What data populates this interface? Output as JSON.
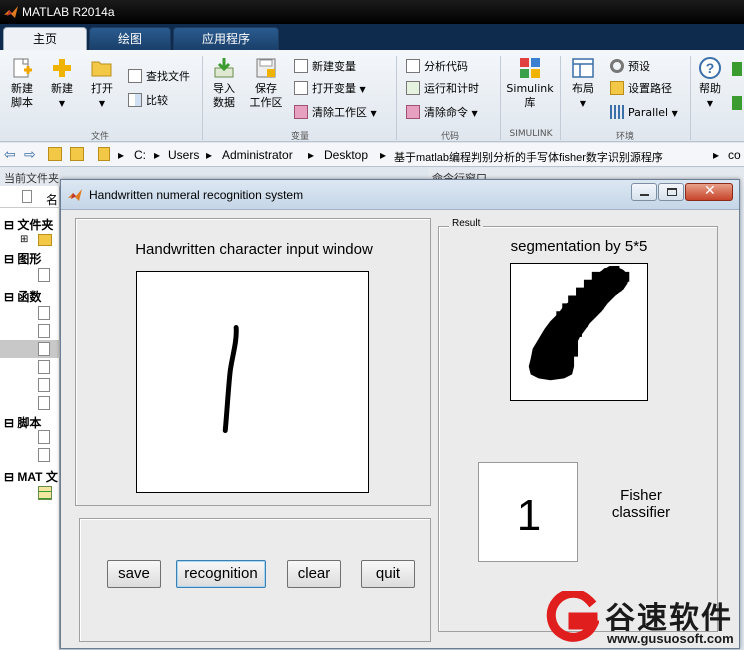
{
  "app": {
    "title": "MATLAB R2014a"
  },
  "tabs": [
    {
      "label": "主页"
    },
    {
      "label": "绘图"
    },
    {
      "label": "应用程序"
    }
  ],
  "ribbon": {
    "new_script": "新建\n脚本",
    "new": "新建",
    "open": "打开",
    "find_files": "查找文件",
    "compare": "比较",
    "import_data": "导入\n数据",
    "save_workspace": "保存\n工作区",
    "new_variable": "新建变量",
    "open_variable": "打开变量",
    "clear_workspace": "清除工作区",
    "analyze_code": "分析代码",
    "run_and_time": "运行和计时",
    "clear_commands": "清除命令",
    "simulink": "Simulink\n库",
    "layout": "布局",
    "preferences": "预设",
    "set_path": "设置路径",
    "parallel": "Parallel",
    "help": "帮助",
    "groups": {
      "file": "文件",
      "variable": "变量",
      "code": "代码",
      "simulink": "SIMULINK",
      "environment": "环境"
    }
  },
  "address": {
    "path": [
      "C:",
      "Users",
      "Administrator",
      "Desktop",
      "基于matlab编程判别分析的手写体fisher数字识别源程序",
      "co"
    ]
  },
  "left_panel": {
    "header": "当前文件夹",
    "col_name": "名",
    "sections": [
      "文件夹",
      "图形",
      "函数",
      "脚本",
      "MAT 文"
    ]
  },
  "command_window": {
    "header": "命令行窗口"
  },
  "figure": {
    "title": "Handwritten numeral recognition system",
    "input_label": "Handwritten character input window",
    "result_legend": "Result",
    "segmentation_label": "segmentation by 5*5",
    "result_digit": "1",
    "classifier_label": "Fisher\nclassifier",
    "buttons": {
      "save": "save",
      "recognition": "recognition",
      "clear": "clear",
      "quit": "quit"
    }
  },
  "watermark": {
    "cn": "谷速软件",
    "url": "www.gusuosoft.com"
  }
}
